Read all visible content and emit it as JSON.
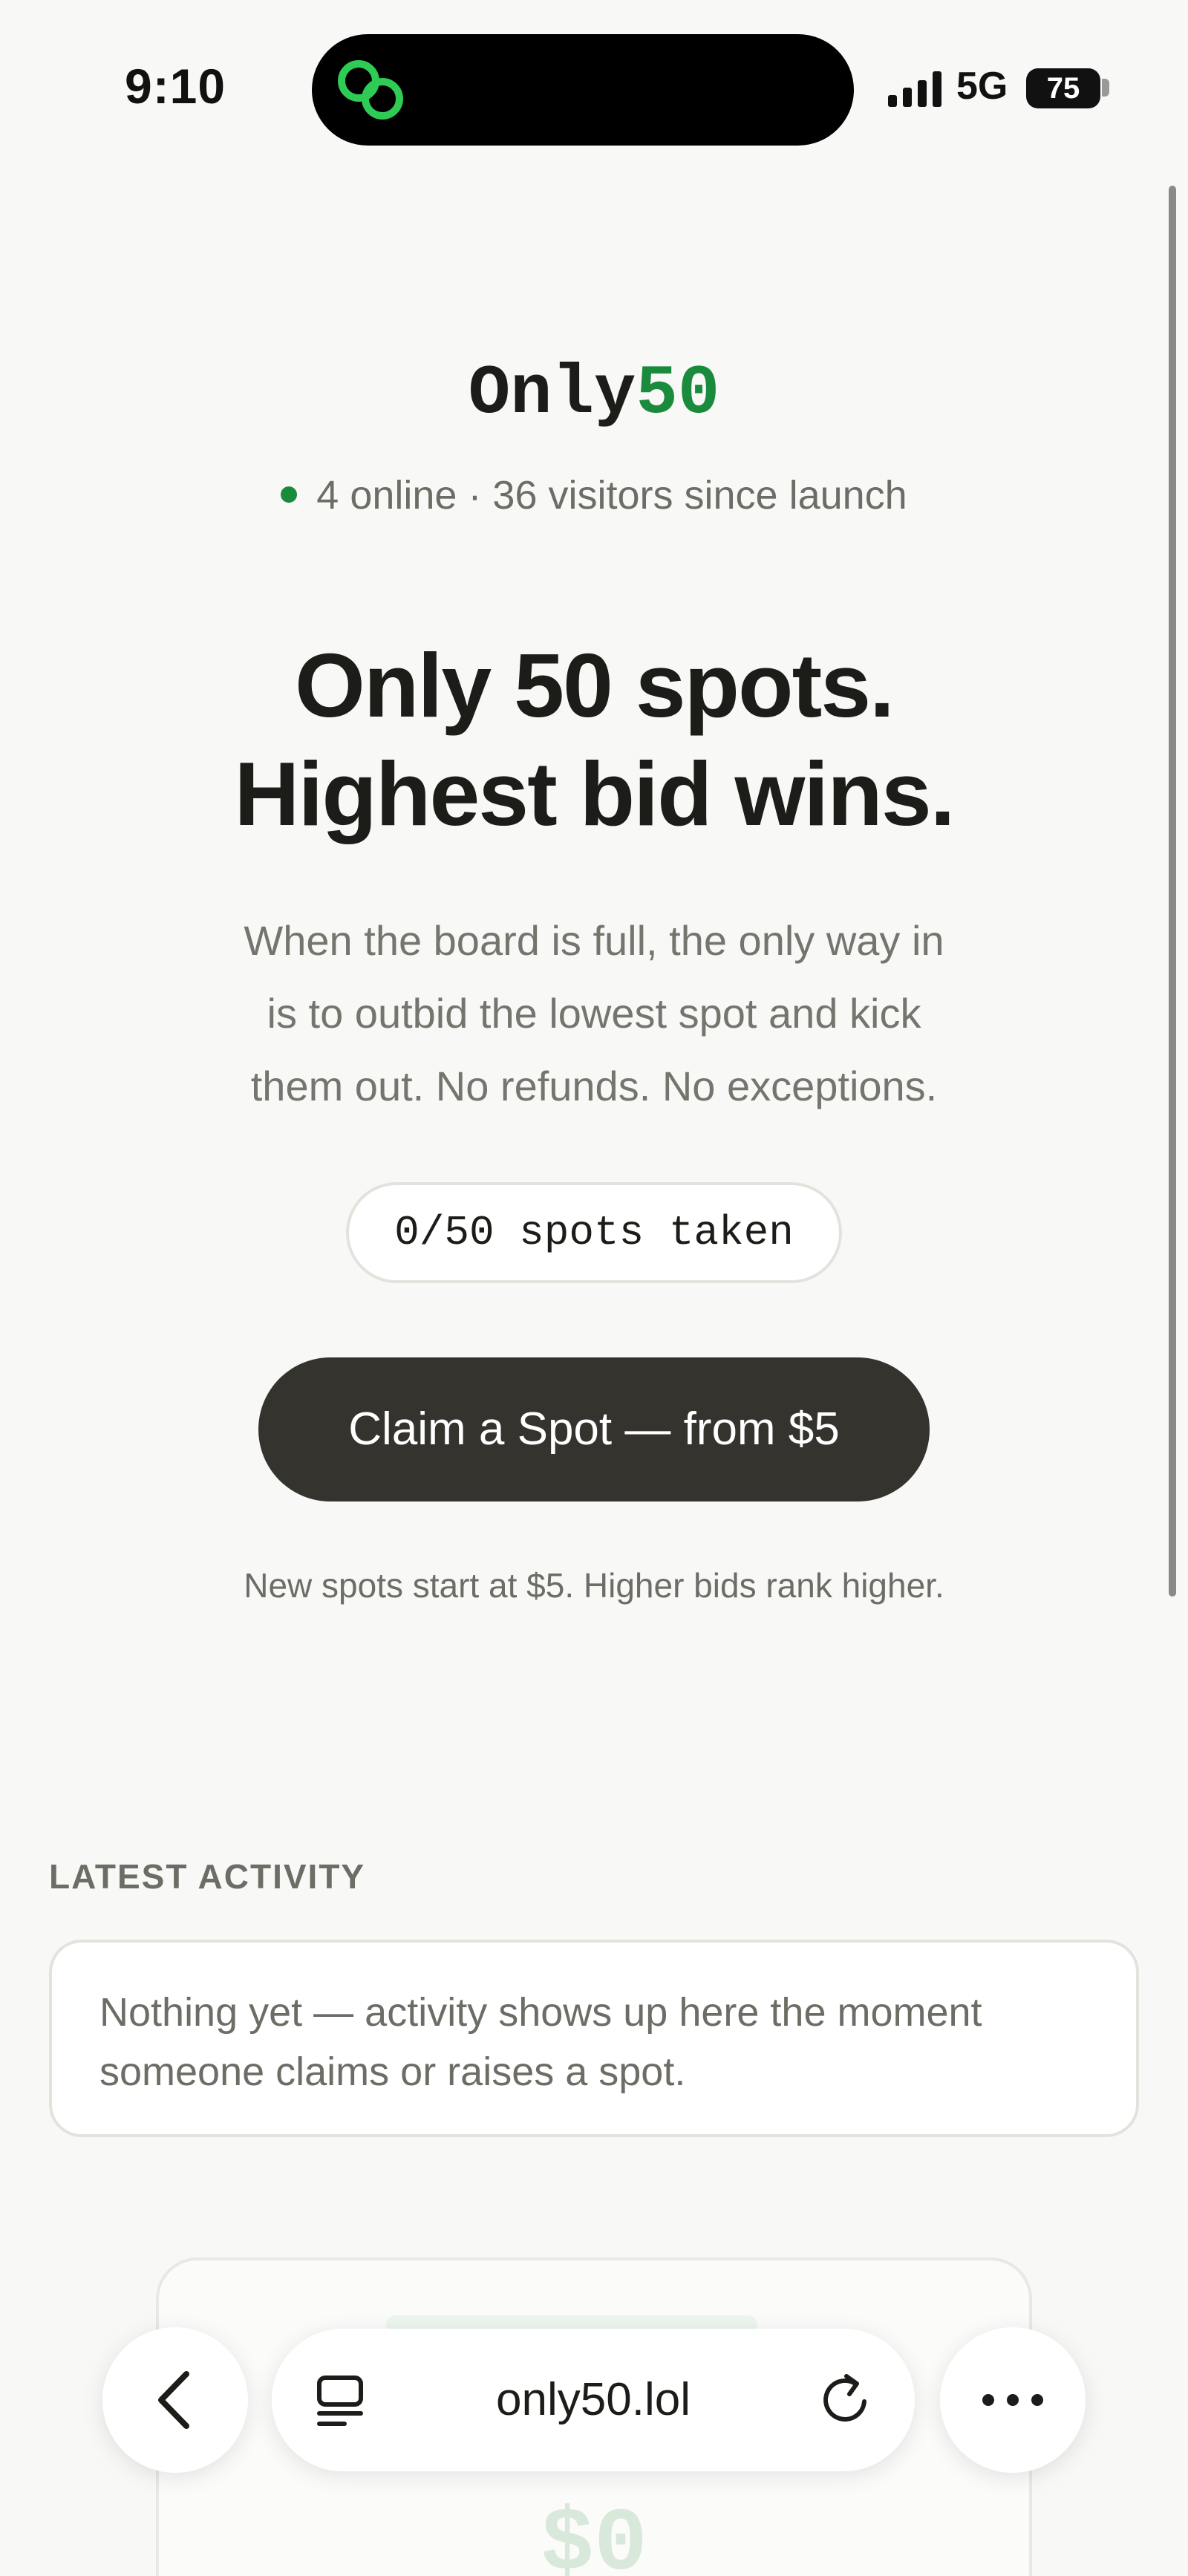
{
  "status_bar": {
    "time": "9:10",
    "network": "5G",
    "battery": "75",
    "island_icon": "link-chain-icon",
    "accent": "#2ecc55"
  },
  "site": {
    "brand_prefix": "Only",
    "brand_number": "50",
    "brand_color": "#1a8a3c",
    "presence": "4 online · 36 visitors since launch"
  },
  "hero": {
    "headline_line1": "Only 50 spots.",
    "headline_line2": "Highest bid wins.",
    "sub_line1": "When the board is full, the only way in",
    "sub_line2": "is to outbid the lowest spot and kick",
    "sub_line3": "them out. No refunds. No exceptions.",
    "spots_counter": "0/50 spots taken",
    "cta_label": "Claim a Spot — from $5",
    "note": "New spots start at $5. Higher bids rank higher."
  },
  "activity": {
    "label": "LATEST ACTIVITY",
    "empty_line1": "Nothing yet — activity shows up here the moment",
    "empty_line2": "someone claims or raises a spot."
  },
  "faded_card": {
    "amount": "$0"
  },
  "browser": {
    "url": "only50.lol",
    "back_icon": "chevron-left-icon",
    "tabs_icon": "tabs-icon",
    "reload_icon": "reload-icon",
    "more_icon": "more-dots-icon"
  }
}
